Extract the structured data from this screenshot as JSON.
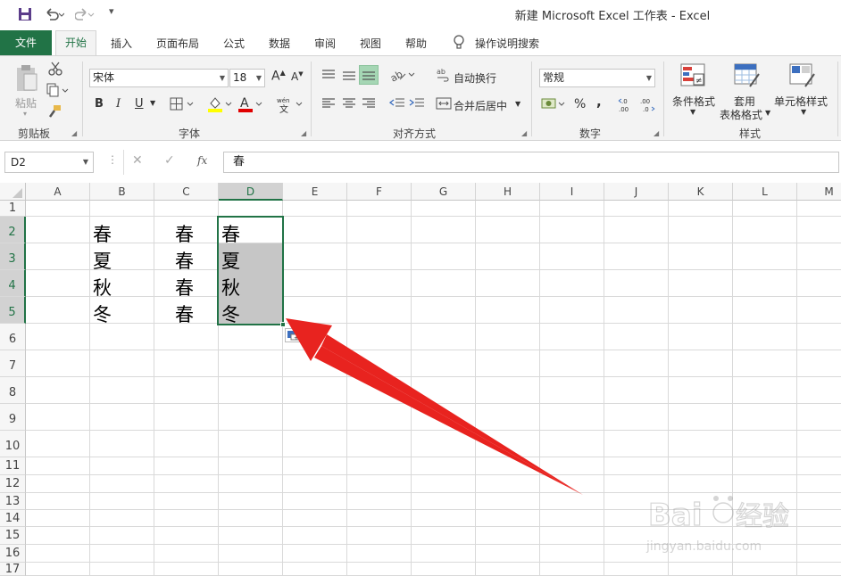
{
  "title_bar": {
    "title": "新建 Microsoft Excel 工作表  -  Excel",
    "save_icon": "save-icon",
    "undo_icon": "undo-icon",
    "redo_icon": "redo-icon"
  },
  "tabs": {
    "items": [
      "文件",
      "开始",
      "插入",
      "页面布局",
      "公式",
      "数据",
      "审阅",
      "视图",
      "帮助"
    ],
    "search_label": "操作说明搜索",
    "active": "开始"
  },
  "ribbon": {
    "clipboard": {
      "paste_label": "粘贴",
      "group_label": "剪贴板"
    },
    "font": {
      "font_name": "宋体",
      "font_size": "18",
      "bold": "B",
      "italic": "I",
      "underline": "U",
      "group_label": "字体"
    },
    "alignment": {
      "wrap_text": "自动换行",
      "merge_center": "合并后居中",
      "group_label": "对齐方式"
    },
    "number": {
      "format": "常规",
      "percent": "%",
      "comma": ",",
      "group_label": "数字"
    },
    "styles": {
      "conditional": "条件格式",
      "table_format_1": "套用",
      "table_format_2": "表格格式",
      "cell_styles": "单元格样式",
      "group_label": "样式"
    }
  },
  "formula_bar": {
    "name_box": "D2",
    "content": "春",
    "fx": "fx"
  },
  "sheet": {
    "columns": [
      "A",
      "B",
      "C",
      "D",
      "E",
      "F",
      "G",
      "H",
      "I",
      "J",
      "K",
      "L",
      "M"
    ],
    "rows": [
      "1",
      "2",
      "3",
      "4",
      "5",
      "6",
      "7",
      "8",
      "9",
      "10",
      "11",
      "12",
      "13",
      "14",
      "15",
      "16",
      "17"
    ],
    "cells": {
      "B2": "春",
      "B3": "夏",
      "B4": "秋",
      "B5": "冬",
      "C2": "春",
      "C3": "春",
      "C4": "春",
      "C5": "春",
      "D2": "春",
      "D3": "夏",
      "D4": "秋",
      "D5": "冬"
    },
    "selection": "D2:D5",
    "accent": "#217346",
    "selection_fill": "#c6c6c6"
  },
  "annotation": {
    "arrow_color": "#e8231f"
  },
  "watermark": {
    "brand": "Baidu经验",
    "url": "jingyan.baidu.com"
  }
}
